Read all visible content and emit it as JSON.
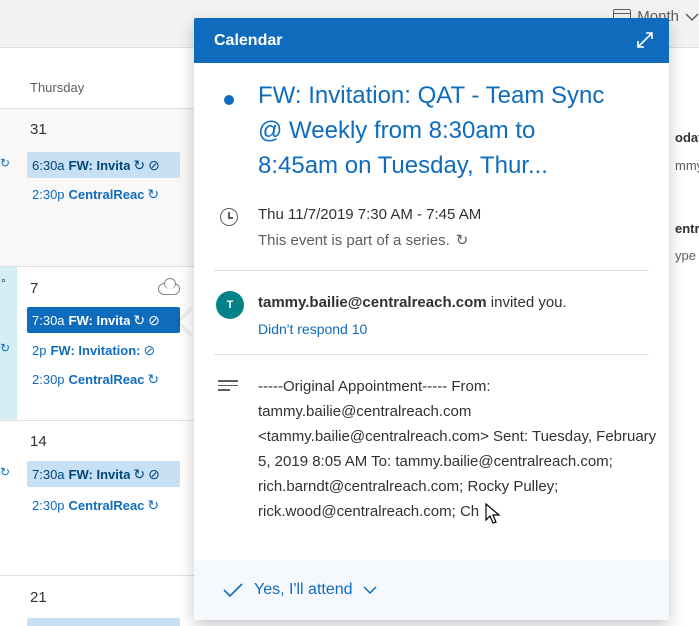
{
  "toolbar": {
    "view_label": "Month"
  },
  "calendar": {
    "day_header": "Thursday",
    "weeks": [
      {
        "day_number": "31",
        "events": [
          {
            "time": "6:30a",
            "subject": "FW: Invita"
          },
          {
            "time": "2:30p",
            "subject": "CentralReac"
          }
        ]
      },
      {
        "day_number": "7",
        "events": [
          {
            "time": "7:30a",
            "subject": "FW: Invita"
          },
          {
            "time": "2p",
            "subject": "FW: Invitation:"
          },
          {
            "time": "2:30p",
            "subject": "CentralReac"
          }
        ]
      },
      {
        "day_number": "14",
        "events": [
          {
            "time": "7:30a",
            "subject": "FW: Invita"
          },
          {
            "time": "2:30p",
            "subject": "CentralReac"
          }
        ]
      },
      {
        "day_number": "21"
      }
    ],
    "left_fragment": "°",
    "right_fragments": [
      "odat",
      "mmy",
      "entra",
      "ype -"
    ]
  },
  "popup": {
    "header_title": "Calendar",
    "event_title": "FW: Invitation: QAT - Team Sync @ Weekly from 8:30am to 8:45am on Tuesday, Thur...",
    "when": "Thu 11/7/2019 7:30 AM - 7:45 AM",
    "series_note": "This event is part of a series.",
    "organizer_initial": "T",
    "organizer_email": "tammy.bailie@centralreach.com",
    "invited_suffix": "invited you.",
    "response_status": "Didn't respond 10",
    "body_text": "-----Original Appointment----- From: tammy.bailie@centralreach.com <tammy.bailie@centralreach.com> Sent: Tuesday, February 5, 2019 8:05 AM To: tammy.bailie@centralreach.com; rich.barndt@centralreach.com; Rocky Pulley; rick.wood@centralreach.com; Ch",
    "rsvp_label": "Yes, I'll attend"
  },
  "colors": {
    "accent": "#0f6cbd",
    "event_light": "#c7e0f4",
    "avatar": "#038387"
  },
  "icons": [
    "calendar-icon",
    "chevron-down-icon",
    "expand-icon",
    "clock-icon",
    "repeat-icon",
    "paperclip-icon",
    "cloud-icon",
    "notes-icon",
    "checkmark-icon",
    "cursor-icon"
  ]
}
